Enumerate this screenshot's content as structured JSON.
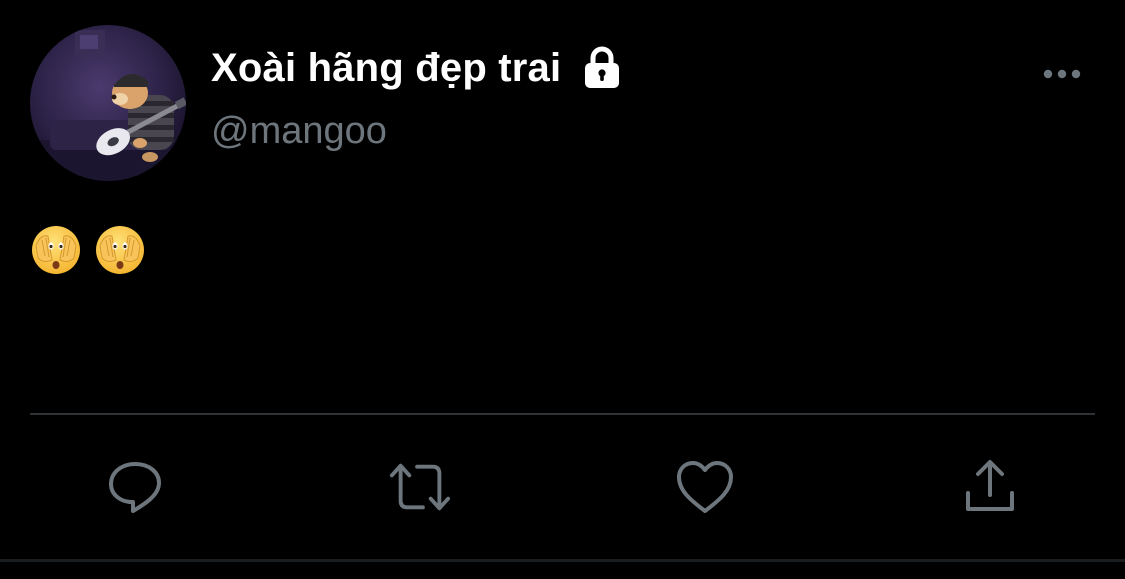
{
  "tweet": {
    "author": {
      "display_name": "Xoài hãng đẹp trai",
      "handle": "@mangoo",
      "protected_icon": "lock-icon",
      "avatar": "avatar-image"
    },
    "more_icon": "more-horizontal-icon",
    "body": {
      "emojis": [
        "🫣",
        "🫣"
      ],
      "emoji_icon": "face-with-peeking-eye-emoji"
    },
    "actions": [
      {
        "name": "reply",
        "icon": "reply-icon"
      },
      {
        "name": "retweet",
        "icon": "retweet-icon"
      },
      {
        "name": "like",
        "icon": "heart-icon"
      },
      {
        "name": "share",
        "icon": "share-icon"
      }
    ]
  },
  "colors": {
    "background": "#000000",
    "text_primary": "#ffffff",
    "text_secondary": "#6e767d",
    "divider": "#2f3336",
    "icon": "#6e767d"
  }
}
